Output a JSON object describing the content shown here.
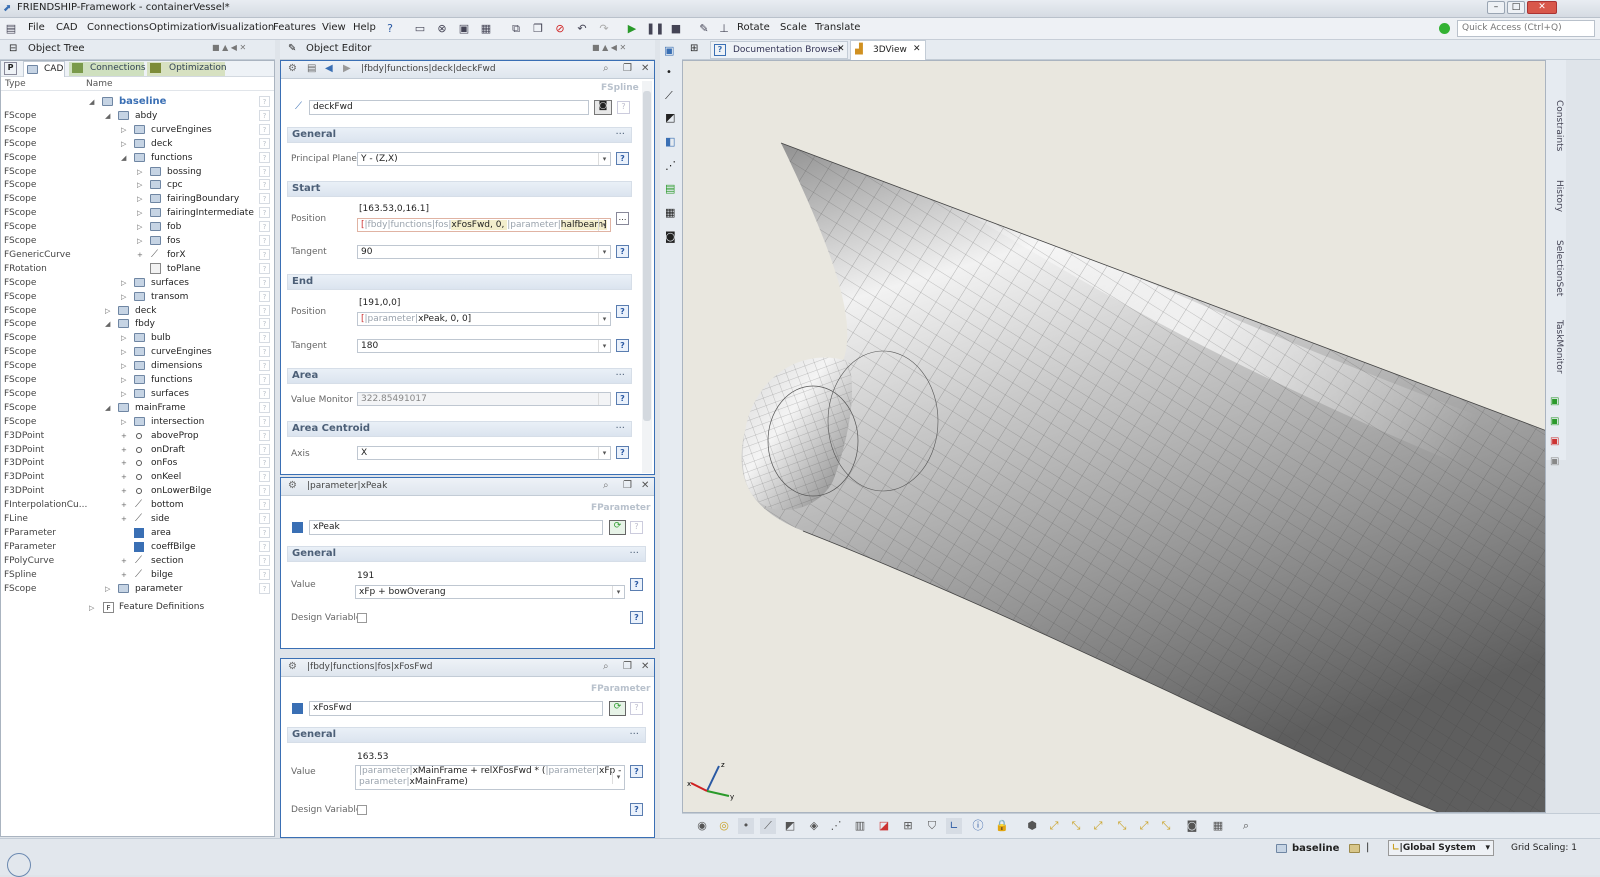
{
  "window": {
    "title": "FRIENDSHIP-Framework - containerVessel*"
  },
  "menu": [
    "File",
    "CAD",
    "Connections",
    "Optimization",
    "Visualization",
    "Features",
    "View",
    "Help"
  ],
  "toolbar": {
    "rotate": "Rotate",
    "scale": "Scale",
    "translate": "Translate",
    "quick_access": "Quick Access (Ctrl+Q)"
  },
  "object_tree": {
    "title": "Object Tree",
    "tabs": [
      "CAD",
      "Connections",
      "Optimization"
    ],
    "col_type": "Type",
    "col_name": "Name",
    "rows": [
      {
        "type": "",
        "name": "baseline",
        "d": 0,
        "icon": "folder",
        "tw": "◢"
      },
      {
        "type": "FScope",
        "name": "abdy",
        "d": 1,
        "icon": "folder",
        "tw": "◢"
      },
      {
        "type": "FScope",
        "name": "curveEngines",
        "d": 2,
        "icon": "folder",
        "tw": "▷"
      },
      {
        "type": "FScope",
        "name": "deck",
        "d": 2,
        "icon": "folder",
        "tw": "▷"
      },
      {
        "type": "FScope",
        "name": "functions",
        "d": 2,
        "icon": "folder",
        "tw": "◢"
      },
      {
        "type": "FScope",
        "name": "bossing",
        "d": 3,
        "icon": "folder",
        "tw": "▷"
      },
      {
        "type": "FScope",
        "name": "cpc",
        "d": 3,
        "icon": "folder",
        "tw": "▷"
      },
      {
        "type": "FScope",
        "name": "fairingBoundary",
        "d": 3,
        "icon": "folder",
        "tw": "▷"
      },
      {
        "type": "FScope",
        "name": "fairingIntermediate",
        "d": 3,
        "icon": "folder",
        "tw": "▷"
      },
      {
        "type": "FScope",
        "name": "fob",
        "d": 3,
        "icon": "folder",
        "tw": "▷"
      },
      {
        "type": "FScope",
        "name": "fos",
        "d": 3,
        "icon": "folder",
        "tw": "▷"
      },
      {
        "type": "FGenericCurve",
        "name": "forX",
        "d": 3,
        "icon": "curve",
        "tw": "+"
      },
      {
        "type": "FRotation",
        "name": "toPlane",
        "d": 3,
        "icon": "rot",
        "tw": ""
      },
      {
        "type": "FScope",
        "name": "surfaces",
        "d": 2,
        "icon": "folder",
        "tw": "▷"
      },
      {
        "type": "FScope",
        "name": "transom",
        "d": 2,
        "icon": "folder",
        "tw": "▷"
      },
      {
        "type": "FScope",
        "name": "deck",
        "d": 1,
        "icon": "folder",
        "tw": "▷"
      },
      {
        "type": "FScope",
        "name": "fbdy",
        "d": 1,
        "icon": "folder",
        "tw": "◢"
      },
      {
        "type": "FScope",
        "name": "bulb",
        "d": 2,
        "icon": "folder",
        "tw": "▷"
      },
      {
        "type": "FScope",
        "name": "curveEngines",
        "d": 2,
        "icon": "folder",
        "tw": "▷"
      },
      {
        "type": "FScope",
        "name": "dimensions",
        "d": 2,
        "icon": "folder",
        "tw": "▷"
      },
      {
        "type": "FScope",
        "name": "functions",
        "d": 2,
        "icon": "folder",
        "tw": "▷"
      },
      {
        "type": "FScope",
        "name": "surfaces",
        "d": 2,
        "icon": "folder",
        "tw": "▷"
      },
      {
        "type": "FScope",
        "name": "mainFrame",
        "d": 1,
        "icon": "folder",
        "tw": "◢"
      },
      {
        "type": "FScope",
        "name": "intersection",
        "d": 2,
        "icon": "folder",
        "tw": "▷"
      },
      {
        "type": "F3DPoint",
        "name": "aboveProp",
        "d": 2,
        "icon": "point",
        "tw": "+"
      },
      {
        "type": "F3DPoint",
        "name": "onDraft",
        "d": 2,
        "icon": "point",
        "tw": "+"
      },
      {
        "type": "F3DPoint",
        "name": "onFos",
        "d": 2,
        "icon": "point",
        "tw": "+"
      },
      {
        "type": "F3DPoint",
        "name": "onKeel",
        "d": 2,
        "icon": "point",
        "tw": "+"
      },
      {
        "type": "F3DPoint",
        "name": "onLowerBilge",
        "d": 2,
        "icon": "point",
        "tw": "+"
      },
      {
        "type": "FInterpolationCu...",
        "name": "bottom",
        "d": 2,
        "icon": "curve",
        "tw": "+"
      },
      {
        "type": "FLine",
        "name": "side",
        "d": 2,
        "icon": "curve",
        "tw": "+"
      },
      {
        "type": "FParameter",
        "name": "area",
        "d": 2,
        "icon": "param",
        "tw": ""
      },
      {
        "type": "FParameter",
        "name": "coeffBilge",
        "d": 2,
        "icon": "param",
        "tw": ""
      },
      {
        "type": "FPolyCurve",
        "name": "section",
        "d": 2,
        "icon": "curve",
        "tw": "+"
      },
      {
        "type": "FSpline",
        "name": "bilge",
        "d": 2,
        "icon": "curve",
        "tw": "+"
      },
      {
        "type": "FScope",
        "name": "parameter",
        "d": 1,
        "icon": "folder",
        "tw": "▷"
      }
    ],
    "feature_definitions": "Feature Definitions"
  },
  "object_editor": {
    "title": "Object Editor",
    "ed1": {
      "path": "|fbdy|functions|deck|deckFwd",
      "type": "FSpline",
      "name": "deckFwd",
      "general": "General",
      "principal_plane_label": "Principal Plane",
      "principal_plane": "Y - (Z,X)",
      "start": "Start",
      "position_label": "Position",
      "start_pos_value": "[163.53,0,16.1]",
      "start_expr": [
        "[",
        "|fbdy|functions|fos|",
        "xFosFwd, 0, ",
        "|parameter|",
        "halfbeam]"
      ],
      "tangent_label": "Tangent",
      "start_tangent": "90",
      "end": "End",
      "end_pos_value": "[191,0,0]",
      "end_expr": [
        "[",
        "|parameter|",
        "xPeak, 0, 0]"
      ],
      "end_tangent": "180",
      "area": "Area",
      "value_monitor_label": "Value Monitor",
      "value_monitor": "322.85491017",
      "area_centroid": "Area Centroid",
      "axis_label": "Axis",
      "axis": "X"
    },
    "ed2": {
      "path": "|parameter|xPeak",
      "type": "FParameter",
      "name": "xPeak",
      "general": "General",
      "value_label": "Value",
      "value": "191",
      "expr": "xFp + bowOverang",
      "design_variable": "Design Variable"
    },
    "ed3": {
      "path": "|fbdy|functions|fos|xFosFwd",
      "type": "FParameter",
      "name": "xFosFwd",
      "general": "General",
      "value_label": "Value",
      "value": "163.53",
      "expr_l1": [
        "|parameter|",
        "xMainFrame + relXFosFwd * (",
        "|parameter|",
        "xFp - |"
      ],
      "expr_l2": [
        "parameter|",
        "xMainFrame)"
      ],
      "design_variable": "Design Variable"
    }
  },
  "viewer": {
    "tabs": [
      "Documentation Browser",
      "3DView"
    ],
    "side_tabs": [
      "Constraints",
      "History",
      "SelectionSet",
      "TaskMonitor"
    ]
  },
  "status": {
    "scope": "baseline",
    "coord_system": "|Global System",
    "grid_scaling": "Grid Scaling: 1"
  },
  "colors": {
    "accent": "#3a6fb4",
    "viewport_bg": "#e9e7df",
    "hull_light": "#f4f4f4",
    "hull_dark": "#6a6a6a"
  }
}
